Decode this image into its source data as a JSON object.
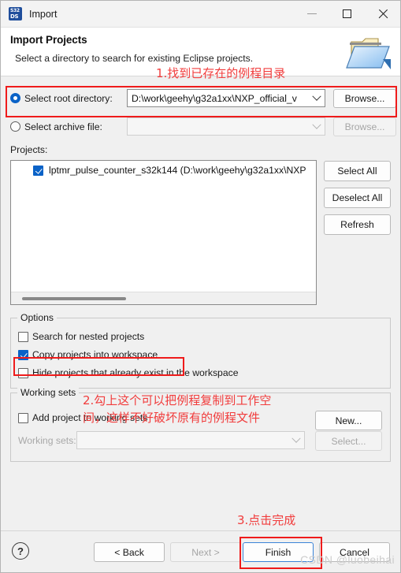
{
  "window": {
    "title": "Import",
    "icon_name": "s32ds-icon",
    "icon_line1": "S32",
    "icon_line2": "DS",
    "minimize_label": "Minimize",
    "maximize_label": "Maximize",
    "close_label": "Close"
  },
  "header": {
    "title": "Import Projects",
    "subtitle": "Select a directory to search for existing Eclipse projects.",
    "icon_name": "import-folder-icon"
  },
  "source": {
    "root_directory": {
      "label": "Select root directory:",
      "selected": true,
      "value": "D:\\work\\geehy\\g32a1xx\\NXP_official_v",
      "browse_label": "Browse..."
    },
    "archive_file": {
      "label": "Select archive file:",
      "selected": false,
      "value": "",
      "browse_label": "Browse...",
      "disabled": true
    }
  },
  "projects": {
    "label": "Projects:",
    "items": [
      {
        "label": "lptmr_pulse_counter_s32k144 (D:\\work\\geehy\\g32a1xx\\NXP",
        "checked": true
      }
    ],
    "buttons": {
      "select_all": "Select All",
      "deselect_all": "Deselect All",
      "refresh": "Refresh"
    }
  },
  "options": {
    "title": "Options",
    "items": [
      {
        "label": "Search for nested projects",
        "checked": false
      },
      {
        "label": "Copy projects into workspace",
        "checked": true
      },
      {
        "label": "Hide projects that already exist in the workspace",
        "checked": false
      }
    ]
  },
  "working_sets": {
    "title": "Working sets",
    "add_checkbox": {
      "label": "Add project to working sets",
      "checked": false
    },
    "field_label": "Working sets:",
    "field_value": "",
    "new_label": "New...",
    "select_label": "Select..."
  },
  "footer": {
    "help_label": "?",
    "back_label": "< Back",
    "next_label": "Next >",
    "finish_label": "Finish",
    "cancel_label": "Cancel"
  },
  "annotations": {
    "accent_color": "#ef1b1b",
    "step1": "1.找到已存在的例程目录",
    "step2_line1": "2.勾上这个可以把例程复制到工作空",
    "step2_line2": "间，这样不好破坏原有的例程文件",
    "step3": "3.点击完成"
  },
  "watermark": "CSDN @luobeihai"
}
